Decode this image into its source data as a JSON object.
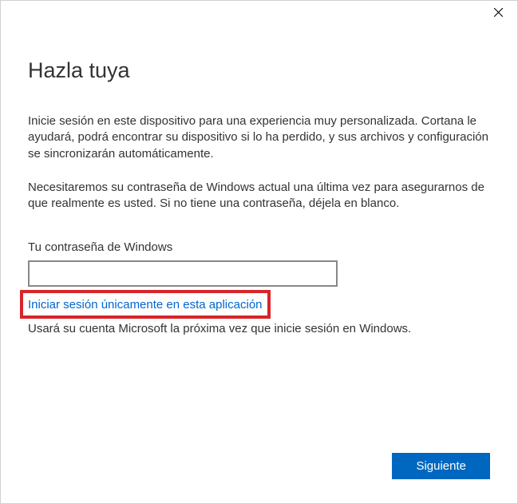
{
  "heading": "Hazla tuya",
  "paragraph1": "Inicie sesión en este dispositivo para una experiencia muy personalizada. Cortana le ayudará, podrá encontrar su dispositivo si lo ha perdido, y sus archivos y configuración se sincronizarán automáticamente.",
  "paragraph2": "Necesitaremos su contraseña de Windows actual una última vez para asegurarnos de que realmente es usted. Si no tiene una contraseña, déjela en blanco.",
  "password_label": "Tu contraseña de Windows",
  "password_value": "",
  "signin_link": "Iniciar sesión únicamente en esta aplicación",
  "sub_note": "Usará su cuenta Microsoft la próxima vez que inicie sesión en Windows.",
  "next_button": "Siguiente",
  "colors": {
    "accent": "#0067c0",
    "link": "#0066cc",
    "highlight": "#d8252a"
  }
}
